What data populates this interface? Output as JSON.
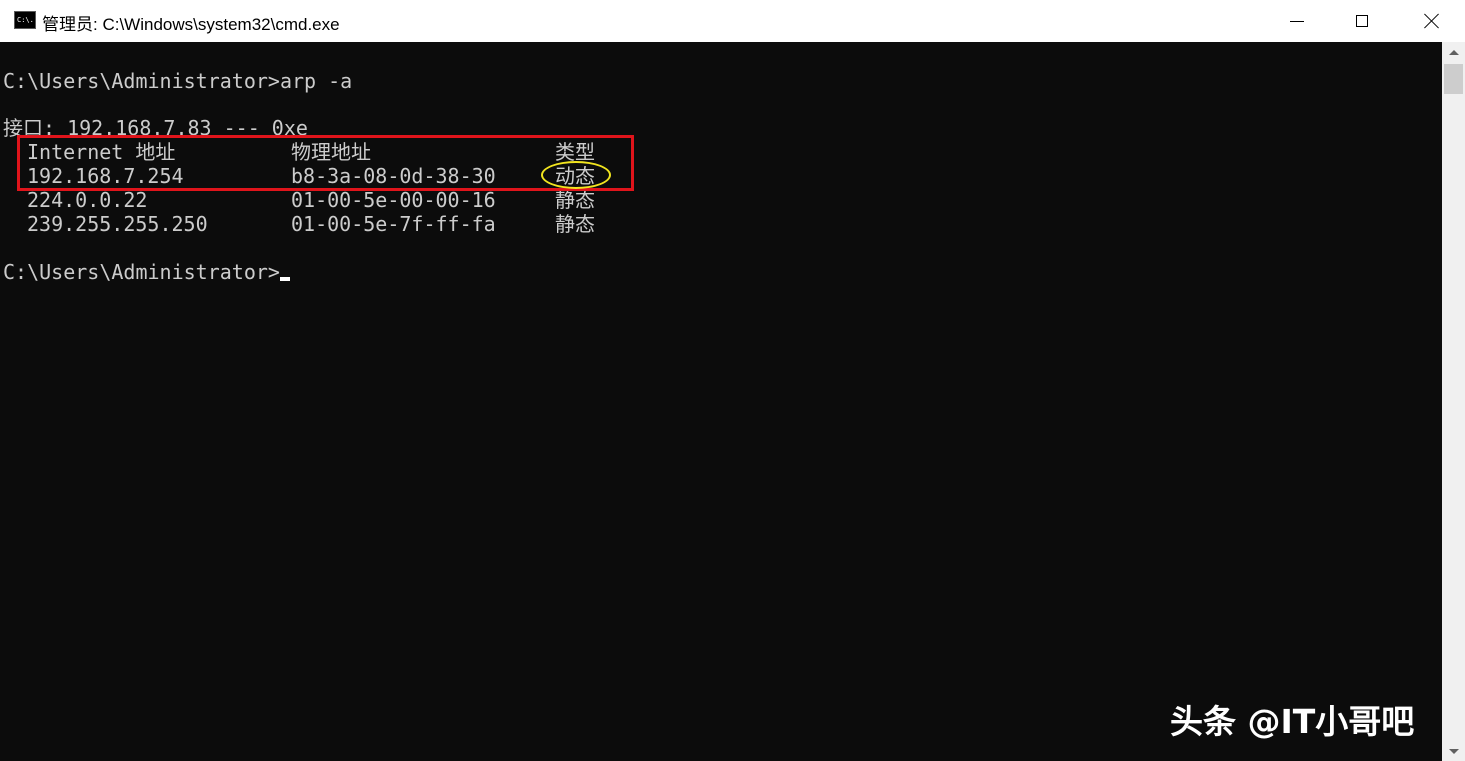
{
  "window": {
    "title": "管理员: C:\\Windows\\system32\\cmd.exe",
    "icon": "cmd-icon",
    "icon_text": "C:\\."
  },
  "console": {
    "command_line": "C:\\Users\\Administrator>arp -a",
    "interface_line": "接口: 192.168.7.83 --- 0xe",
    "headers": {
      "ip": "Internet 地址",
      "mac": "物理地址",
      "type": "类型"
    },
    "rows": [
      {
        "ip": "192.168.7.254",
        "mac": "b8-3a-08-0d-38-30",
        "type": "动态"
      },
      {
        "ip": "224.0.0.22",
        "mac": "01-00-5e-00-00-16",
        "type": "静态"
      },
      {
        "ip": "239.255.255.250",
        "mac": "01-00-5e-7f-ff-fa",
        "type": "静态"
      }
    ],
    "prompt": "C:\\Users\\Administrator>"
  },
  "watermark": "头条 @IT小哥吧",
  "colors": {
    "console_bg": "#0c0c0c",
    "console_text": "#cccccc",
    "highlight_rect": "#e0141b",
    "highlight_ellipse": "#f2e51f"
  }
}
